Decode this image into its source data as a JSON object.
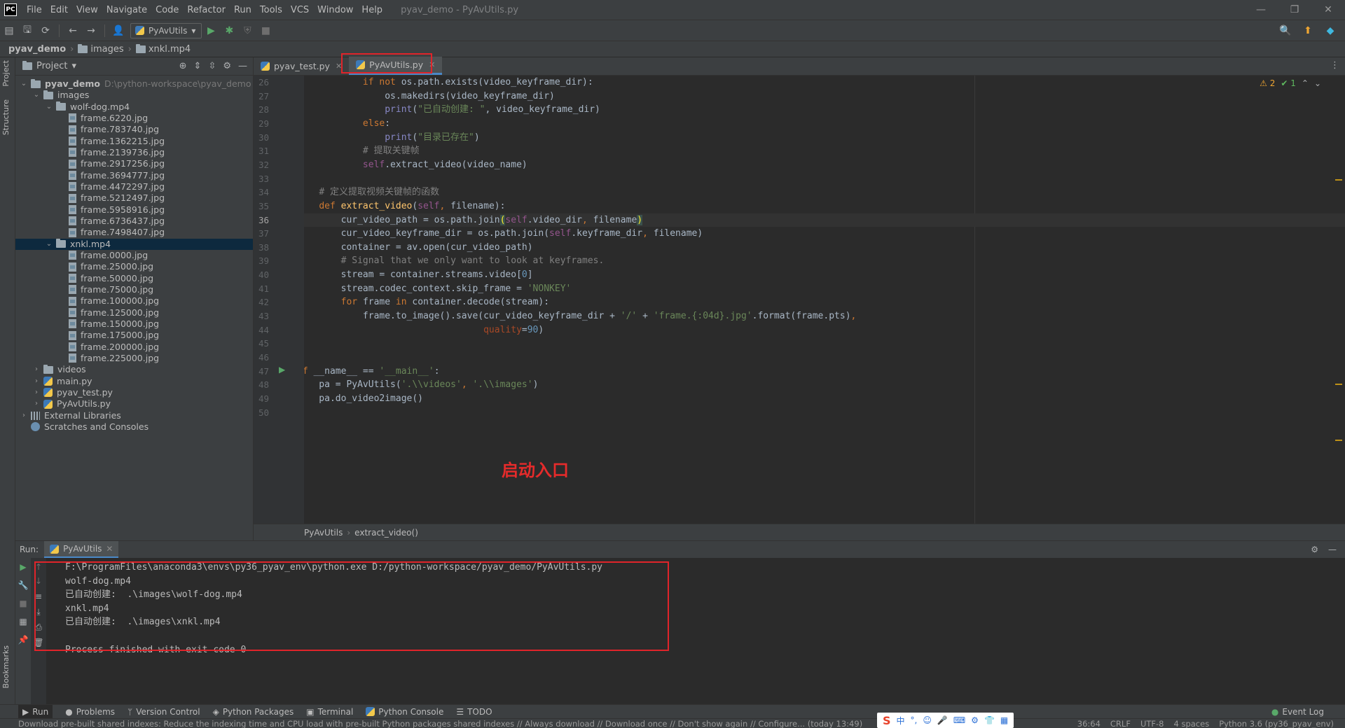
{
  "app": {
    "logo": "PC",
    "menus": [
      "File",
      "Edit",
      "View",
      "Navigate",
      "Code",
      "Refactor",
      "Run",
      "Tools",
      "VCS",
      "Window",
      "Help"
    ],
    "window_title": "pyav_demo - PyAvUtils.py"
  },
  "toolbar": {
    "run_config": "PyAvUtils"
  },
  "breadcrumb": [
    "pyav_demo",
    "images",
    "xnkl.mp4"
  ],
  "left_strip": {
    "project": "Project",
    "structure": "Structure",
    "bookmarks": "Bookmarks"
  },
  "project_panel": {
    "title": "Project",
    "tree": [
      {
        "indent": 0,
        "chev": "down",
        "icon": "folder",
        "label": "pyav_demo",
        "extra": "D:\\python-workspace\\pyav_demo"
      },
      {
        "indent": 1,
        "chev": "down",
        "icon": "folder",
        "label": "images"
      },
      {
        "indent": 2,
        "chev": "down",
        "icon": "folder",
        "label": "wolf-dog.mp4"
      },
      {
        "indent": 3,
        "icon": "file",
        "label": "frame.6220.jpg"
      },
      {
        "indent": 3,
        "icon": "file",
        "label": "frame.783740.jpg"
      },
      {
        "indent": 3,
        "icon": "file",
        "label": "frame.1362215.jpg"
      },
      {
        "indent": 3,
        "icon": "file",
        "label": "frame.2139736.jpg"
      },
      {
        "indent": 3,
        "icon": "file",
        "label": "frame.2917256.jpg"
      },
      {
        "indent": 3,
        "icon": "file",
        "label": "frame.3694777.jpg"
      },
      {
        "indent": 3,
        "icon": "file",
        "label": "frame.4472297.jpg"
      },
      {
        "indent": 3,
        "icon": "file",
        "label": "frame.5212497.jpg"
      },
      {
        "indent": 3,
        "icon": "file",
        "label": "frame.5958916.jpg"
      },
      {
        "indent": 3,
        "icon": "file",
        "label": "frame.6736437.jpg"
      },
      {
        "indent": 3,
        "icon": "file",
        "label": "frame.7498407.jpg"
      },
      {
        "indent": 2,
        "chev": "down",
        "icon": "folder",
        "label": "xnkl.mp4",
        "selected": true
      },
      {
        "indent": 3,
        "icon": "file",
        "label": "frame.0000.jpg"
      },
      {
        "indent": 3,
        "icon": "file",
        "label": "frame.25000.jpg"
      },
      {
        "indent": 3,
        "icon": "file",
        "label": "frame.50000.jpg"
      },
      {
        "indent": 3,
        "icon": "file",
        "label": "frame.75000.jpg"
      },
      {
        "indent": 3,
        "icon": "file",
        "label": "frame.100000.jpg"
      },
      {
        "indent": 3,
        "icon": "file",
        "label": "frame.125000.jpg"
      },
      {
        "indent": 3,
        "icon": "file",
        "label": "frame.150000.jpg"
      },
      {
        "indent": 3,
        "icon": "file",
        "label": "frame.175000.jpg"
      },
      {
        "indent": 3,
        "icon": "file",
        "label": "frame.200000.jpg"
      },
      {
        "indent": 3,
        "icon": "file",
        "label": "frame.225000.jpg"
      },
      {
        "indent": 1,
        "chev": "right",
        "icon": "folder",
        "label": "videos"
      },
      {
        "indent": 1,
        "chev": "right",
        "icon": "py",
        "label": "main.py"
      },
      {
        "indent": 1,
        "chev": "right",
        "icon": "py",
        "label": "pyav_test.py"
      },
      {
        "indent": 1,
        "chev": "right",
        "icon": "py",
        "label": "PyAvUtils.py"
      },
      {
        "indent": 0,
        "chev": "right",
        "icon": "lib",
        "label": "External Libraries"
      },
      {
        "indent": 0,
        "icon": "scratch",
        "label": "Scratches and Consoles"
      }
    ]
  },
  "editor": {
    "tabs": [
      {
        "label": "pyav_test.py",
        "active": false
      },
      {
        "label": "PyAvUtils.py",
        "active": true
      }
    ],
    "inspections": {
      "warnings": "2",
      "ok": "1"
    },
    "current_line": 36,
    "lines": [
      {
        "n": 26,
        "segs": [
          [
            "",
            "            "
          ],
          [
            "kw",
            "if not "
          ],
          [
            "",
            "os.path.exists(video_keyframe_dir):"
          ]
        ]
      },
      {
        "n": 27,
        "segs": [
          [
            "",
            "                os.makedirs(video_keyframe_dir)"
          ]
        ]
      },
      {
        "n": 28,
        "segs": [
          [
            "",
            "                "
          ],
          [
            "bi",
            "print"
          ],
          [
            "",
            "("
          ],
          [
            "str",
            "\"已自动创建: \""
          ],
          [
            "",
            ", video_keyframe_dir)"
          ]
        ]
      },
      {
        "n": 29,
        "segs": [
          [
            "",
            "            "
          ],
          [
            "kw",
            "else"
          ],
          [
            "",
            ":"
          ]
        ]
      },
      {
        "n": 30,
        "segs": [
          [
            "",
            "                "
          ],
          [
            "bi",
            "print"
          ],
          [
            "",
            "("
          ],
          [
            "str",
            "\"目录已存在\""
          ],
          [
            "",
            ")"
          ]
        ]
      },
      {
        "n": 31,
        "segs": [
          [
            "",
            "            "
          ],
          [
            "cmt",
            "# 提取关键帧"
          ]
        ]
      },
      {
        "n": 32,
        "segs": [
          [
            "",
            "            "
          ],
          [
            "self",
            "self"
          ],
          [
            "",
            ".extract_video(video_name)"
          ]
        ]
      },
      {
        "n": 33,
        "segs": [
          [
            "",
            ""
          ]
        ]
      },
      {
        "n": 34,
        "segs": [
          [
            "",
            "    "
          ],
          [
            "cmt",
            "# 定义提取视频关键帧的函数"
          ]
        ]
      },
      {
        "n": 35,
        "segs": [
          [
            "",
            "    "
          ],
          [
            "kw",
            "def "
          ],
          [
            "fn",
            "extract_video"
          ],
          [
            "",
            "("
          ],
          [
            "self",
            "self"
          ],
          [
            "kw",
            ", "
          ],
          [
            "",
            "filename):"
          ]
        ]
      },
      {
        "n": 36,
        "segs": [
          [
            "",
            "        cur_video_path = os.path.join"
          ],
          [
            "hl",
            "("
          ],
          [
            "self",
            "self"
          ],
          [
            "",
            ".video_dir"
          ],
          [
            "kw",
            ", "
          ],
          [
            "",
            "filename"
          ],
          [
            "hl",
            ")"
          ]
        ]
      },
      {
        "n": 37,
        "segs": [
          [
            "",
            "        cur_video_keyframe_dir = os.path.join("
          ],
          [
            "self",
            "self"
          ],
          [
            "",
            ".keyframe_dir"
          ],
          [
            "kw",
            ", "
          ],
          [
            "",
            "filename)"
          ]
        ]
      },
      {
        "n": 38,
        "segs": [
          [
            "",
            "        container = av.open(cur_video_path)"
          ]
        ]
      },
      {
        "n": 39,
        "segs": [
          [
            "",
            "        "
          ],
          [
            "cmt",
            "# Signal that we only want to look at keyframes."
          ]
        ]
      },
      {
        "n": 40,
        "segs": [
          [
            "",
            "        stream = container.streams.video["
          ],
          [
            "num",
            "0"
          ],
          [
            "",
            "]"
          ]
        ]
      },
      {
        "n": 41,
        "segs": [
          [
            "",
            "        stream.codec_context.skip_frame = "
          ],
          [
            "str",
            "'NONKEY'"
          ]
        ]
      },
      {
        "n": 42,
        "segs": [
          [
            "",
            "        "
          ],
          [
            "kw",
            "for "
          ],
          [
            "",
            "frame "
          ],
          [
            "kw",
            "in "
          ],
          [
            "",
            "container.decode(stream):"
          ]
        ]
      },
      {
        "n": 43,
        "segs": [
          [
            "",
            "            frame.to_image().save(cur_video_keyframe_dir + "
          ],
          [
            "str",
            "'/'"
          ],
          [
            "",
            " + "
          ],
          [
            "str",
            "'frame.{:04d}.jpg'"
          ],
          [
            "",
            ".format(frame.pts)"
          ],
          [
            "kw",
            ","
          ]
        ]
      },
      {
        "n": 44,
        "segs": [
          [
            "",
            "                                  "
          ],
          [
            "kwarg",
            "quality"
          ],
          [
            "",
            "="
          ],
          [
            "num",
            "90"
          ],
          [
            "",
            ")"
          ]
        ]
      },
      {
        "n": 45,
        "segs": [
          [
            "",
            ""
          ]
        ]
      },
      {
        "n": 46,
        "segs": [
          [
            "",
            ""
          ]
        ]
      },
      {
        "n": 47,
        "segs": [
          [
            "kw",
            "if "
          ],
          [
            "",
            "__name__ == "
          ],
          [
            "str",
            "'__main__'"
          ],
          [
            "",
            ":"
          ]
        ]
      },
      {
        "n": 48,
        "segs": [
          [
            "",
            "    pa = PyAvUtils("
          ],
          [
            "str",
            "'.\\\\videos'"
          ],
          [
            "kw",
            ", "
          ],
          [
            "str",
            "'.\\\\images'"
          ],
          [
            "",
            ")"
          ]
        ]
      },
      {
        "n": 49,
        "segs": [
          [
            "",
            "    pa.do_video2image()"
          ]
        ]
      },
      {
        "n": 50,
        "segs": [
          [
            "",
            ""
          ]
        ]
      }
    ],
    "annotation": "启动入口",
    "breadcrumb": [
      "PyAvUtils",
      "extract_video()"
    ]
  },
  "run_panel": {
    "label": "Run:",
    "tab": "PyAvUtils",
    "console": [
      "F:\\ProgramFiles\\anaconda3\\envs\\py36_pyav_env\\python.exe D:/python-workspace/pyav_demo/PyAvUtils.py",
      "wolf-dog.mp4",
      "已自动创建:  .\\images\\wolf-dog.mp4",
      "xnkl.mp4",
      "已自动创建:  .\\images\\xnkl.mp4",
      "",
      "Process finished with exit code 0"
    ]
  },
  "bottom_tools": [
    "Run",
    "Problems",
    "Version Control",
    "Python Packages",
    "Terminal",
    "Python Console",
    "TODO"
  ],
  "event_log": "Event Log",
  "status": {
    "message": "Download pre-built shared indexes: Reduce the indexing time and CPU load with pre-built Python packages shared indexes // Always download // Download once // Don't show again // Configure... (today 13:49)",
    "position": "36:64",
    "line_sep": "CRLF",
    "encoding": "UTF-8",
    "indent": "4 spaces",
    "interpreter": "Python 3.6 (py36_pyav_env)"
  },
  "ime": {
    "logo": "S",
    "mode": "中"
  },
  "colors": {
    "accent": "#4a88c7",
    "highlight_red": "#e0242a",
    "bg": "#2b2b2b",
    "panel": "#3c3f41"
  }
}
